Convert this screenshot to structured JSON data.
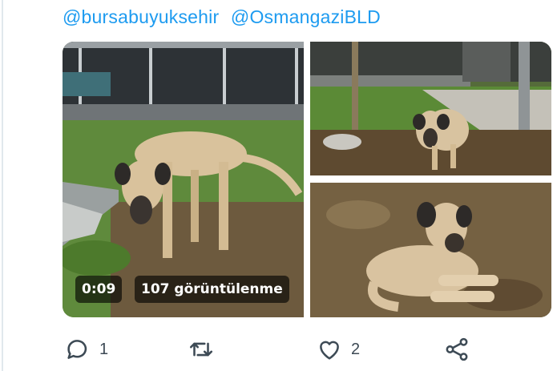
{
  "tweet": {
    "mentions": [
      "@bursabuyuksehir",
      "@OsmangaziBLD"
    ]
  },
  "media": {
    "video_duration": "0:09",
    "view_count_label": "107 görüntülenme"
  },
  "actions": {
    "reply_count": "1",
    "retweet_count": "",
    "like_count": "2"
  },
  "colors": {
    "link": "#1d9bf0",
    "icon": "#3d4a55",
    "overlay": "rgba(0,0,0,0.62)"
  }
}
